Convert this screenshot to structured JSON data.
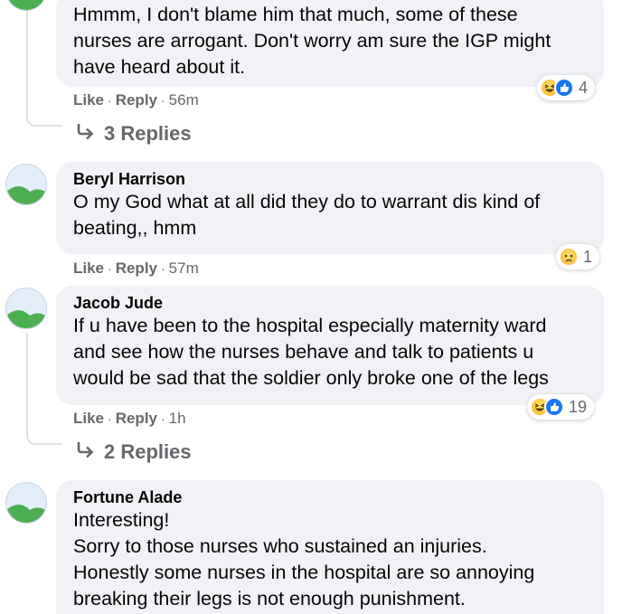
{
  "comments": [
    {
      "author": "",
      "text": "Hmmm, I don't blame him that much, some of these\nnurses are arrogant. Don't worry am sure the IGP might\nhave heard about it.",
      "reaction_count": "4",
      "like_label": "Like",
      "reply_label": "Reply",
      "time": "56m",
      "replies_label": "3 Replies"
    },
    {
      "author": "Beryl Harrison",
      "text": "O my God what at all did they do to warrant dis kind of\nbeating,, hmm",
      "reaction_count": "1",
      "like_label": "Like",
      "reply_label": "Reply",
      "time": "57m"
    },
    {
      "author": "Jacob Jude",
      "text": "If u have been to the hospital especially maternity ward\nand see how the nurses behave and talk to patients u\nwould be sad that the soldier only broke one of the legs",
      "reaction_count": "19",
      "like_label": "Like",
      "reply_label": "Reply",
      "time": "1h",
      "replies_label": "2 Replies"
    },
    {
      "author": "Fortune Alade",
      "text": "Interesting!\nSorry to those nurses who sustained an injuries.\nHonestly some nurses in the hospital are so annoying\nbreaking their legs is not enough punishment."
    }
  ],
  "icons": {
    "reaction_haha": "haha-reaction-icon",
    "reaction_like": "like-reaction-icon",
    "reaction_sad": "sad-reaction-icon",
    "reply_arrow": "reply-arrow-icon",
    "avatar": "default-avatar-icon"
  },
  "colors": {
    "bubble_bg": "#f0f2f5",
    "secondary_text": "#65676b",
    "like_blue": "#1877f2",
    "reaction_yellow": "#f7b125"
  }
}
